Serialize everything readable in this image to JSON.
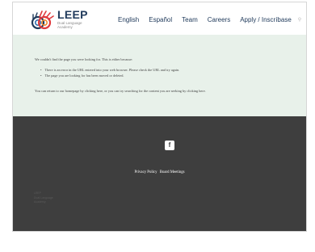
{
  "header": {
    "logo": {
      "title": "LEEP",
      "subtitle": "Dual Language Academy"
    },
    "nav": [
      {
        "label": "English",
        "name": "nav-item-english"
      },
      {
        "label": "Español",
        "name": "nav-item-espanol"
      },
      {
        "label": "Team",
        "name": "nav-item-team"
      },
      {
        "label": "Careers",
        "name": "nav-item-careers"
      },
      {
        "label": "Apply / Inscríbase",
        "name": "nav-item-apply"
      }
    ],
    "search_icon": "search-icon",
    "search_glyph": "⚲"
  },
  "notice": {
    "intro": "We couldn't find the page you were looking for. This is either because:",
    "reasons": [
      "There is an error in the URL entered into your web browser. Please check the URL and try again.",
      "The page you are looking for has been moved or deleted."
    ],
    "outro": "You can return to our homepage by clicking here, or you can try searching for the content you are seeking by clicking here.",
    "background_color": "#e8f1ea"
  },
  "footer": {
    "facebook_glyph": "f",
    "links": [
      "Privacy Policy",
      "Board Meetings"
    ],
    "muted_lines": [
      "LEEP",
      "Dual Language",
      "Academy"
    ],
    "background_color": "#3e3e3e"
  },
  "colors": {
    "brand_navy": "#213b5c",
    "logo_red": "#e03a3e",
    "logo_orange": "#f08a2e"
  }
}
